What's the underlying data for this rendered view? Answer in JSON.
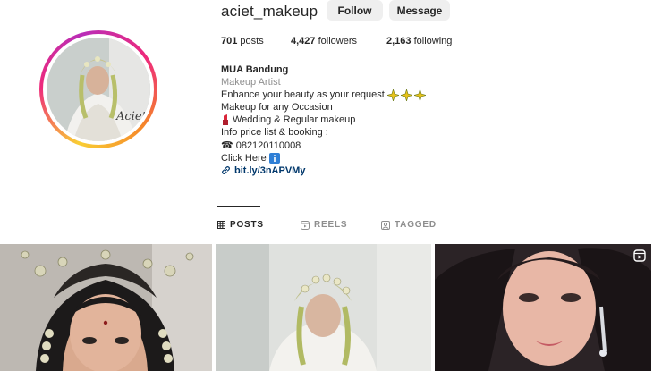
{
  "profile": {
    "username": "aciet_makeup",
    "avatar_caption": "Aciet",
    "follow_label": "Follow",
    "message_label": "Message"
  },
  "stats": {
    "posts_count": "701",
    "posts_label": " posts",
    "followers_count": "4,427",
    "followers_label": " followers",
    "following_count": "2,163",
    "following_label": " following"
  },
  "bio": {
    "name": "MUA Bandung",
    "category": "Makeup Artist",
    "line1": "Enhance your beauty as your request",
    "line2": "Makeup for any Occasion",
    "line3": "Wedding & Regular makeup",
    "line4": "Info price list & booking :",
    "phone_icon": "☎",
    "phone": "082120110008",
    "line6": "Click Here",
    "link": "bit.ly/3nAPVMy"
  },
  "tabs": [
    {
      "label": "POSTS",
      "icon": "grid-icon",
      "active": true
    },
    {
      "label": "REELS",
      "icon": "reels-icon",
      "active": false
    },
    {
      "label": "TAGGED",
      "icon": "tagged-icon",
      "active": false
    }
  ],
  "colors": {
    "link": "#00376b",
    "muted": "#8e8e8e",
    "button_bg": "#efefef",
    "divider": "#dbdbdb"
  }
}
